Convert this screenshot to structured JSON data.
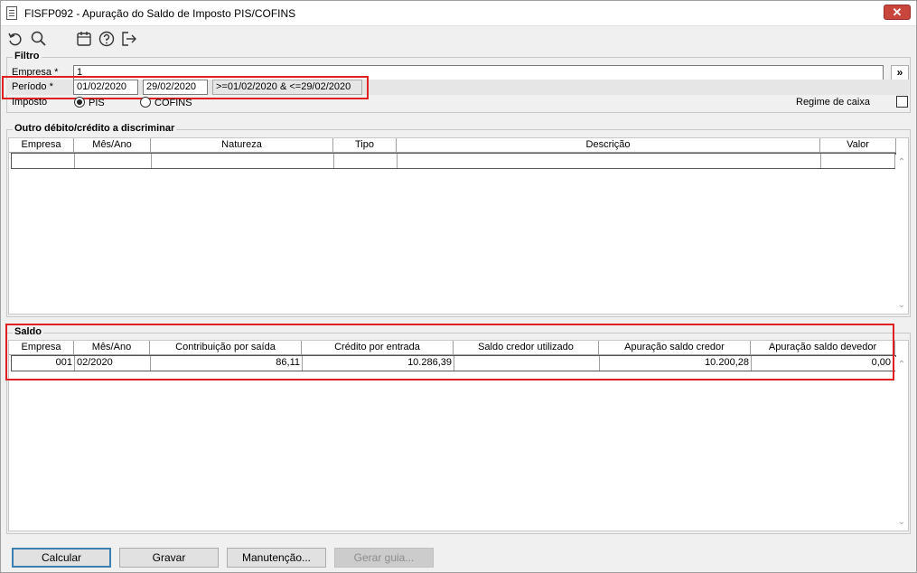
{
  "window": {
    "title": "FISFP092 - Apuração do Saldo de Imposto PIS/COFINS",
    "close_glyph": "✕"
  },
  "toolbar": {
    "icons": [
      "undo-icon",
      "search-icon",
      "calendar-icon",
      "help-icon",
      "exit-icon"
    ]
  },
  "filtro": {
    "legend": "Filtro",
    "empresa_label": "Empresa *",
    "empresa_value": "1",
    "lookup_glyph": "»",
    "periodo_label": "Período *",
    "periodo_from": "01/02/2020",
    "periodo_to": "29/02/2020",
    "periodo_expr": ">=01/02/2020 & <=29/02/2020",
    "imposto_label": "Imposto",
    "imposto_options": [
      "PIS",
      "COFINS"
    ],
    "imposto_selected": "PIS",
    "regime_label": "Regime de caixa",
    "regime_checked": false
  },
  "outro": {
    "legend": "Outro débito/crédito a discriminar",
    "columns": [
      "Empresa",
      "Mês/Ano",
      "Natureza",
      "Tipo",
      "Descrição",
      "Valor"
    ],
    "rows": [
      [
        "",
        "",
        "",
        "",
        "",
        ""
      ]
    ]
  },
  "saldo": {
    "legend": "Saldo",
    "columns": [
      "Empresa",
      "Mês/Ano",
      "Contribuição por saída",
      "Crédito por entrada",
      "Saldo credor utilizado",
      "Apuração saldo credor",
      "Apuração saldo devedor"
    ],
    "rows": [
      [
        "001",
        "02/2020",
        "86,11",
        "10.286,39",
        "",
        "10.200,28",
        "0,00"
      ]
    ]
  },
  "buttons": {
    "calcular": "Calcular",
    "gravar": "Gravar",
    "manutencao": "Manutenção...",
    "gerar_guia": "Gerar guia..."
  },
  "colors": {
    "highlight": "#e02020",
    "close_button": "#c9463d",
    "default_button_border": "#3c7fb1"
  }
}
